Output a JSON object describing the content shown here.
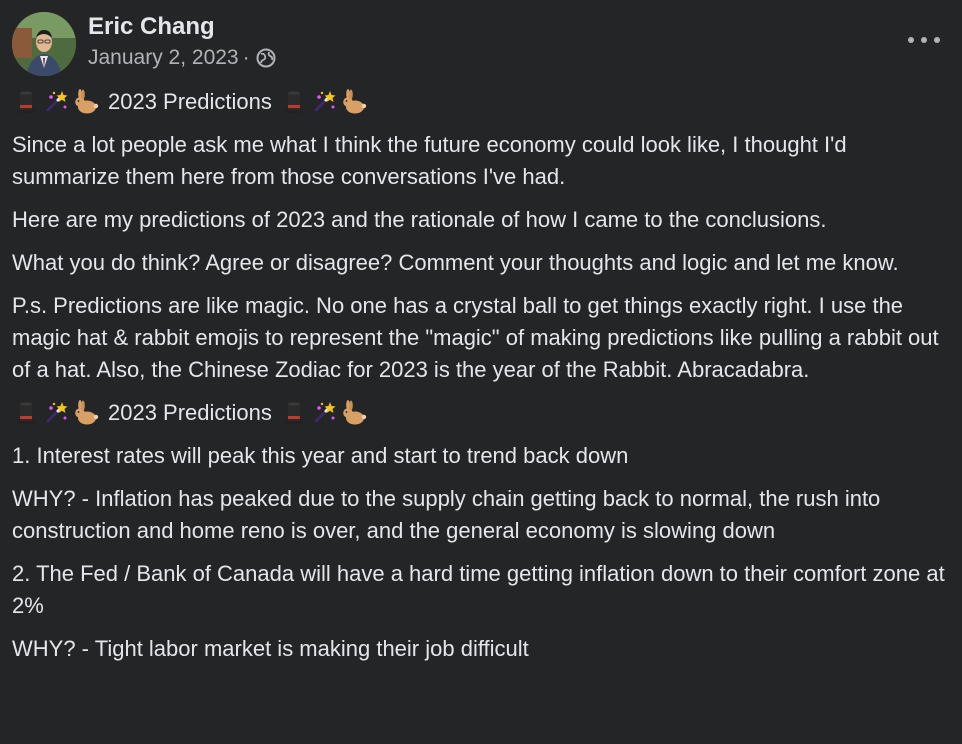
{
  "post": {
    "author": "Eric Chang",
    "date": "January 2, 2023",
    "separator": "·",
    "privacy_icon": "globe-icon",
    "more_icon": "more-options-icon",
    "paragraphs": {
      "title1": "2023 Predictions",
      "p1": "Since a lot people ask me what I think the future economy could look like, I thought I'd summarize them here from those conversations I've had.",
      "p2": "Here are my predictions of 2023 and the rationale of how I came to the conclusions.",
      "p3": "What you do think? Agree or disagree? Comment your thoughts and logic and let me know.",
      "p4": "P.s. Predictions are like magic. No one has a crystal ball to get things exactly right. I use the magic hat & rabbit emojis to represent the \"magic\" of making predictions like pulling a rabbit out of a hat. Also, the Chinese Zodiac for 2023 is the year of the Rabbit. Abracadabra.",
      "title2": "2023 Predictions",
      "p5": "1. Interest rates will peak this year and start to trend back down",
      "p6": "WHY? - Inflation has peaked due to the supply chain getting back to normal, the rush into construction and home reno is over, and the general economy is slowing down",
      "p7": "2. The Fed / Bank of Canada will have a hard time getting inflation down to their comfort zone at 2%",
      "p8": "WHY? - Tight labor market is making their job difficult"
    },
    "emojis": [
      "top-hat-emoji",
      "magic-wand-sparkles-emoji",
      "rabbit-emoji"
    ]
  },
  "colors": {
    "background": "#242526",
    "text_primary": "#e4e6eb",
    "text_secondary": "#b0b3b8"
  }
}
